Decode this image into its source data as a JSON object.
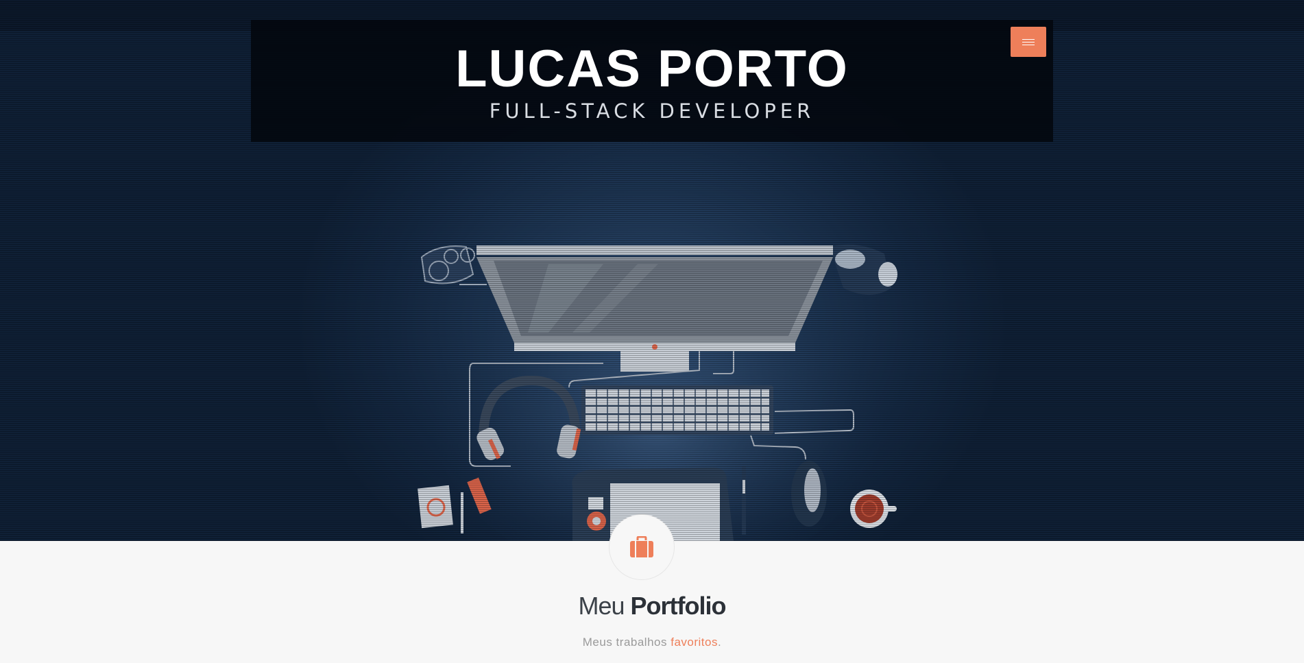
{
  "header": {
    "title": "LUCAS PORTO",
    "subtitle": "FULL-STACK DEVELOPER",
    "menu_icon": "hamburger-menu-icon"
  },
  "hero": {
    "illustration": "desk-workspace-illustration"
  },
  "portfolio": {
    "icon": "briefcase-icon",
    "title_light": "Meu",
    "title_bold": "Portfolio",
    "tagline_prefix": "Meus trabalhos",
    "tagline_accent": "favoritos",
    "tagline_suffix": "."
  },
  "colors": {
    "accent": "#ee7f5a",
    "hero_background": "#142842",
    "header_box": "#03070e",
    "section_background": "#f7f7f7"
  }
}
